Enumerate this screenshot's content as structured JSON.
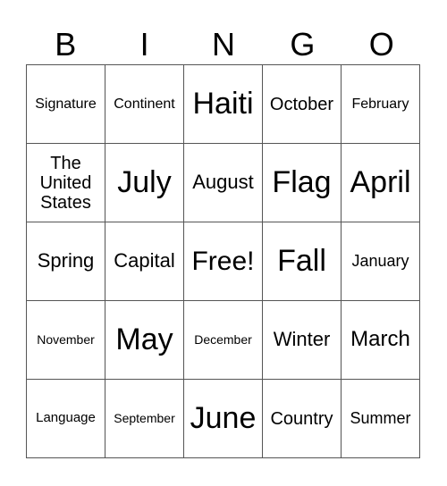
{
  "header": [
    "B",
    "I",
    "N",
    "G",
    "O"
  ],
  "cells": [
    [
      {
        "t": "Signature",
        "s": 16
      },
      {
        "t": "Continent",
        "s": 16
      },
      {
        "t": "Haiti",
        "s": 34
      },
      {
        "t": "October",
        "s": 20
      },
      {
        "t": "February",
        "s": 16
      }
    ],
    [
      {
        "t": "The United States",
        "s": 20
      },
      {
        "t": "July",
        "s": 34
      },
      {
        "t": "August",
        "s": 22
      },
      {
        "t": "Flag",
        "s": 34
      },
      {
        "t": "April",
        "s": 34
      }
    ],
    [
      {
        "t": "Spring",
        "s": 22
      },
      {
        "t": "Capital",
        "s": 22
      },
      {
        "t": "Free!",
        "s": 30
      },
      {
        "t": "Fall",
        "s": 34
      },
      {
        "t": "January",
        "s": 18
      }
    ],
    [
      {
        "t": "November",
        "s": 14
      },
      {
        "t": "May",
        "s": 34
      },
      {
        "t": "December",
        "s": 14
      },
      {
        "t": "Winter",
        "s": 22
      },
      {
        "t": "March",
        "s": 24
      }
    ],
    [
      {
        "t": "Language",
        "s": 15
      },
      {
        "t": "September",
        "s": 14
      },
      {
        "t": "June",
        "s": 34
      },
      {
        "t": "Country",
        "s": 20
      },
      {
        "t": "Summer",
        "s": 18
      }
    ]
  ]
}
